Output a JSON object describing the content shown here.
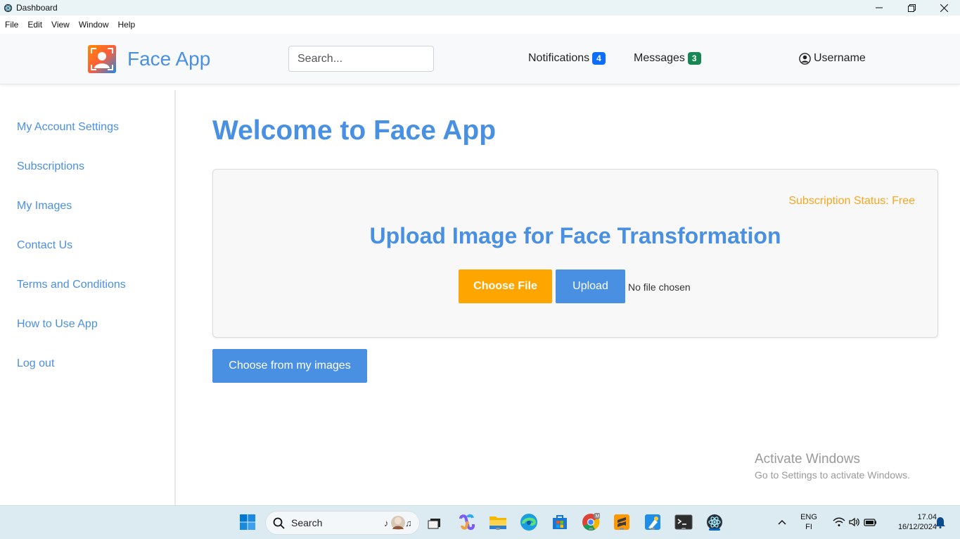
{
  "window": {
    "title": "Dashboard"
  },
  "menu": [
    "File",
    "Edit",
    "View",
    "Window",
    "Help"
  ],
  "header": {
    "brand": "Face App",
    "search_placeholder": "Search...",
    "notifications_label": "Notifications",
    "notifications_count": "4",
    "messages_label": "Messages",
    "messages_count": "3",
    "username": "Username"
  },
  "sidebar": {
    "items": [
      {
        "label": "My Account Settings"
      },
      {
        "label": "Subscriptions"
      },
      {
        "label": "My Images"
      },
      {
        "label": "Contact Us"
      },
      {
        "label": "Terms and Conditions"
      },
      {
        "label": "How to Use App"
      },
      {
        "label": "Log out"
      }
    ]
  },
  "main": {
    "welcome": "Welcome to Face App",
    "subscription_status": "Subscription Status: Free",
    "upload_title": "Upload Image for Face Transformation",
    "choose_file_label": "Choose File",
    "upload_label": "Upload",
    "no_file_text": "No file chosen",
    "choose_from_images_label": "Choose from my images"
  },
  "watermark": {
    "line1": "Activate Windows",
    "line2": "Go to Settings to activate Windows."
  },
  "taskbar": {
    "search_label": "Search",
    "language": "ENG",
    "region": "FI",
    "time": "17.04",
    "date": "16/12/2024"
  },
  "colors": {
    "accent": "#4a90e2",
    "orange": "#ffa500",
    "status": "#f5a623"
  }
}
